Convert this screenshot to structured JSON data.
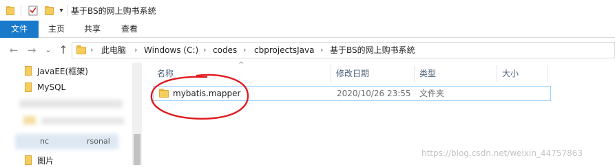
{
  "window": {
    "title": "基于BS的网上购书系统",
    "quick_access_dropdown": "▾"
  },
  "ribbon": {
    "tabs": [
      "文件",
      "主页",
      "共享",
      "查看"
    ]
  },
  "nav": {
    "back": "←",
    "forward": "→",
    "recent": "⌄",
    "up": "↑"
  },
  "address": {
    "crumbs": [
      "此电脑",
      "Windows (C:)",
      "codes",
      "cbprojectsJava",
      "基于BS的网上购书系统"
    ],
    "separator": "›"
  },
  "sidebar": {
    "items": [
      "JavaEE(框架)",
      "MySQL"
    ],
    "obscured_fragments": [
      "nc",
      "rsonal",
      "图片"
    ]
  },
  "columns": {
    "name": "名称",
    "date": "修改日期",
    "type": "类型",
    "size": "大小",
    "sort_indicator": "^"
  },
  "files": [
    {
      "name": "mybatis.mapper",
      "date": "2020/10/26 23:55",
      "type": "文件夹"
    }
  ],
  "watermark": "https://blog.csdn.net/weixin_44757863",
  "colors": {
    "accent": "#1979ca",
    "selection_border": "#99d1ff",
    "folder": "#f5cd5c",
    "annotation": "#e0191e"
  },
  "icons": {
    "folder": "folder-icon",
    "checklist": "properties-icon",
    "back": "back-arrow-icon",
    "forward": "forward-arrow-icon",
    "up": "up-arrow-icon"
  }
}
